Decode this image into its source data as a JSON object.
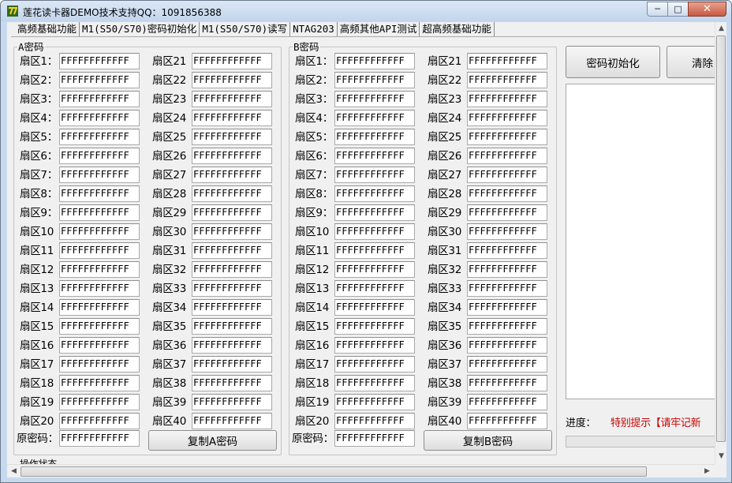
{
  "window": {
    "title": "莲花读卡器DEMO技术支持QQ：1091856388",
    "min": "─",
    "max": "□",
    "close": "✕"
  },
  "tabs": [
    "高频基础功能",
    "M1(S50/S70)密码初始化",
    "M1(S50/S70)读写",
    "NTAG203",
    "高频其他API测试",
    "超高频基础功能"
  ],
  "groupA": {
    "legend": "A密码",
    "value": "FFFFFFFFFFFF",
    "sectors": [
      "扇区1：",
      "扇区2：",
      "扇区3：",
      "扇区4：",
      "扇区5：",
      "扇区6：",
      "扇区7：",
      "扇区8：",
      "扇区9：",
      "扇区10",
      "扇区11",
      "扇区12",
      "扇区13",
      "扇区14",
      "扇区15",
      "扇区16",
      "扇区17",
      "扇区18",
      "扇区19",
      "扇区20",
      "扇区21",
      "扇区22",
      "扇区23",
      "扇区24",
      "扇区25",
      "扇区26",
      "扇区27",
      "扇区28",
      "扇区29",
      "扇区30",
      "扇区31",
      "扇区32",
      "扇区33",
      "扇区34",
      "扇区35",
      "扇区36",
      "扇区37",
      "扇区38",
      "扇区39",
      "扇区40"
    ],
    "orig_label": "原密码：",
    "copy_button": "复制A密码"
  },
  "groupB": {
    "legend": "B密码",
    "value": "FFFFFFFFFFFF",
    "sectors": [
      "扇区1：",
      "扇区2：",
      "扇区3：",
      "扇区4：",
      "扇区5：",
      "扇区6：",
      "扇区7：",
      "扇区8：",
      "扇区9：",
      "扇区10",
      "扇区11",
      "扇区12",
      "扇区13",
      "扇区14",
      "扇区15",
      "扇区16",
      "扇区17",
      "扇区18",
      "扇区19",
      "扇区20",
      "扇区21",
      "扇区22",
      "扇区23",
      "扇区24",
      "扇区25",
      "扇区26",
      "扇区27",
      "扇区28",
      "扇区29",
      "扇区30",
      "扇区31",
      "扇区32",
      "扇区33",
      "扇区34",
      "扇区35",
      "扇区36",
      "扇区37",
      "扇区38",
      "扇区39",
      "扇区40"
    ],
    "orig_label": "原密码：",
    "copy_button": "复制B密码"
  },
  "actions": {
    "init_button": "密码初始化",
    "clear_button": "清除"
  },
  "progress": {
    "label": "进度：",
    "notice": "特别提示【请牢记新",
    "notice_color": "#cc0000"
  },
  "bottom_label": "操作状态"
}
